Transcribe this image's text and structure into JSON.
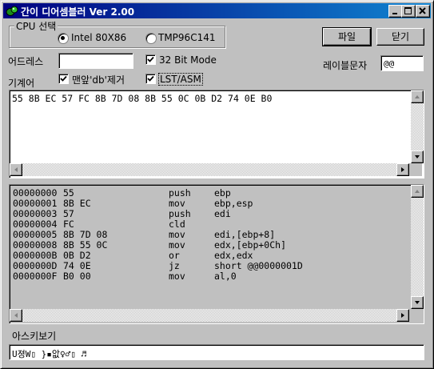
{
  "window": {
    "title": "간이 디어셈블러 Ver 2.00",
    "minimize_label": "minimize",
    "maximize_label": "maximize",
    "close_label": "close"
  },
  "cpu_group": {
    "label": "CPU 선택",
    "options": [
      {
        "label": "Intel 80X86",
        "selected": true
      },
      {
        "label": "TMP96C141",
        "selected": false
      }
    ]
  },
  "buttons": {
    "file": "파일",
    "close": "닫기"
  },
  "address": {
    "label": "어드레스",
    "value": ""
  },
  "mode32": {
    "label": "32 Bit Mode",
    "checked": true
  },
  "label_char": {
    "label": "레이블문자",
    "value": "@@"
  },
  "machine_code": {
    "label": "기계어",
    "remove_db": {
      "label": "맨앞'db'제거",
      "checked": true
    },
    "lst_asm": {
      "label": "LST/ASM",
      "checked": true
    },
    "content": "55 8B EC 57 FC 8B 7D 08 8B 55 0C 0B D2 74 0E B0"
  },
  "disassembly": {
    "rows": [
      {
        "addr": "00000000",
        "bytes": "55",
        "mnemonic": "push",
        "operands": "ebp"
      },
      {
        "addr": "00000001",
        "bytes": "8B EC",
        "mnemonic": "mov",
        "operands": "ebp,esp"
      },
      {
        "addr": "00000003",
        "bytes": "57",
        "mnemonic": "push",
        "operands": "edi"
      },
      {
        "addr": "00000004",
        "bytes": "FC",
        "mnemonic": "cld",
        "operands": ""
      },
      {
        "addr": "00000005",
        "bytes": "8B 7D 08",
        "mnemonic": "mov",
        "operands": "edi,[ebp+8]"
      },
      {
        "addr": "00000008",
        "bytes": "8B 55 0C",
        "mnemonic": "mov",
        "operands": "edx,[ebp+0Ch]"
      },
      {
        "addr": "0000000B",
        "bytes": "0B D2",
        "mnemonic": "or",
        "operands": "edx,edx"
      },
      {
        "addr": "0000000D",
        "bytes": "74 0E",
        "mnemonic": "jz",
        "operands": "short @@0000001D"
      },
      {
        "addr": "0000000F",
        "bytes": "B0 00",
        "mnemonic": "mov",
        "operands": "al,0"
      }
    ]
  },
  "ascii_view": {
    "label": "아스키보기",
    "content": "U졍W▯ }▪앖♀♂▯ ♬"
  },
  "colors": {
    "face": "#c0c0c0",
    "title_start": "#000080",
    "title_end": "#1084d0",
    "title_icon": "#1a8a1a"
  }
}
